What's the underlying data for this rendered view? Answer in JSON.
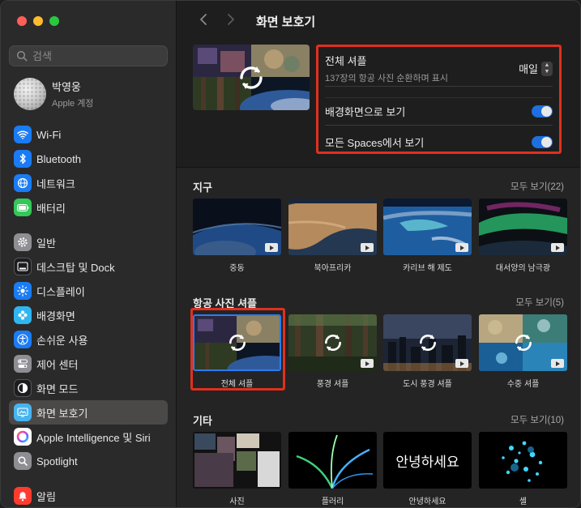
{
  "window": {
    "title": "화면 보호기"
  },
  "search": {
    "placeholder": "검색"
  },
  "account": {
    "name": "박영웅",
    "subtitle": "Apple 계정"
  },
  "sidebar": {
    "items": [
      {
        "label": "Wi-Fi",
        "icon": "wifi-icon",
        "color": "#1a7cf5"
      },
      {
        "label": "Bluetooth",
        "icon": "bluetooth-icon",
        "color": "#1a7cf5"
      },
      {
        "label": "네트워크",
        "icon": "globe-icon",
        "color": "#1a7cf5"
      },
      {
        "label": "배터리",
        "icon": "battery-icon",
        "color": "#34c759"
      },
      {
        "label": "일반",
        "icon": "gear-icon",
        "color": "#8e8e93"
      },
      {
        "label": "데스크탑 및 Dock",
        "icon": "dock-icon",
        "color": "#1c1c1e"
      },
      {
        "label": "디스플레이",
        "icon": "sun-icon",
        "color": "#1a7cf5"
      },
      {
        "label": "배경화면",
        "icon": "flower-icon",
        "color": "#2fb6f0"
      },
      {
        "label": "손쉬운 사용",
        "icon": "accessibility-icon",
        "color": "#1a7cf5"
      },
      {
        "label": "제어 센터",
        "icon": "switches-icon",
        "color": "#8e8e93"
      },
      {
        "label": "화면 모드",
        "icon": "appearance-icon",
        "color": "#1c1c1e"
      },
      {
        "label": "화면 보호기",
        "icon": "screensaver-icon",
        "color": "#47b4f0",
        "active": true
      },
      {
        "label": "Apple Intelligence 및 Siri",
        "icon": "siri-icon",
        "color": "#ffffff"
      },
      {
        "label": "Spotlight",
        "icon": "spotlight-icon",
        "color": "#8e8e93"
      },
      {
        "label": "알림",
        "icon": "bell-icon",
        "color": "#ff3b30"
      }
    ]
  },
  "settings": {
    "shuffle_label": "전체 셔플",
    "shuffle_sub": "137장의 항공 사진 순환하며 표시",
    "frequency_value": "매일",
    "wallpaper_label": "배경화면으로 보기",
    "wallpaper_on": true,
    "spaces_label": "모든 Spaces에서 보기",
    "spaces_on": true
  },
  "sections": {
    "earth": {
      "title": "지구",
      "more": "모두 보기(22)",
      "tiles": [
        {
          "label": "중동"
        },
        {
          "label": "북아프리카"
        },
        {
          "label": "카리브 해 제도"
        },
        {
          "label": "대서양의 남극광"
        }
      ]
    },
    "shuffle": {
      "title": "항공 사진 셔플",
      "more": "모두 보기(5)",
      "tiles": [
        {
          "label": "전체 셔플",
          "selected": true
        },
        {
          "label": "풍경 셔플"
        },
        {
          "label": "도시 풍경 셔플"
        },
        {
          "label": "수중 셔플"
        }
      ]
    },
    "other": {
      "title": "기타",
      "more": "모두 보기(10)",
      "tiles": [
        {
          "label": "사진"
        },
        {
          "label": "플러리"
        },
        {
          "label": "안녕하세요",
          "art_text": "안녕하세요"
        },
        {
          "label": "셸"
        }
      ]
    }
  }
}
